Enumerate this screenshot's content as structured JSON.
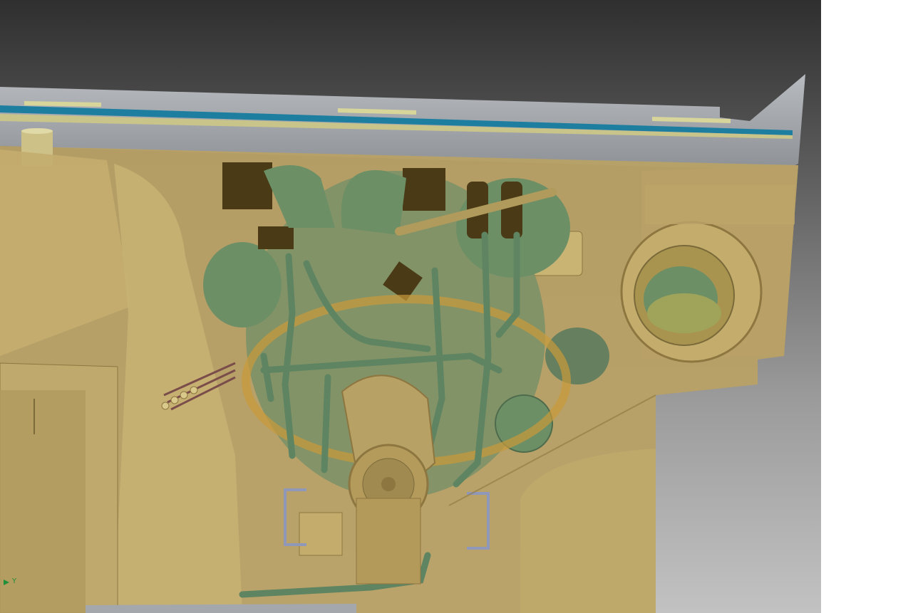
{
  "viewport": {
    "background_top": "#2f2f2f",
    "background_bottom": "#c2c2c2",
    "colors": {
      "tan": "#b39a5a",
      "tan_light": "#cdb77a",
      "tan_dark": "#8d7640",
      "green": "#6d8f66",
      "green_dark": "#4e6b4c",
      "dark_brown": "#4a3a16",
      "rail_gray": "#a4a8ac",
      "rail_blue": "#1d7ea0",
      "rail_yellow": "#c9c58a",
      "bracket_gray": "#8f98b8",
      "flange_orange": "#c99a3a"
    }
  },
  "triad": {
    "axis_label": "Y",
    "icon": "coordinate-triad-icon",
    "color": "#1f8f3a"
  }
}
